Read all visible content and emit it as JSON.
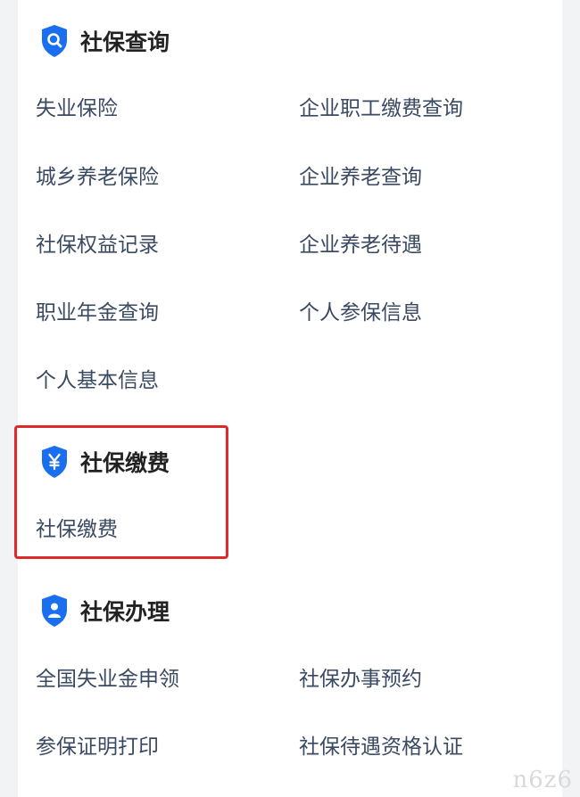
{
  "colors": {
    "accent": "#1a6ff0",
    "highlight": "#e0292b",
    "link": "#3a4a62",
    "title": "#222222"
  },
  "sections": {
    "query": {
      "title": "社保查询",
      "icon": "search-icon",
      "items": [
        "失业保险",
        "企业职工缴费查询",
        "城乡养老保险",
        "企业养老查询",
        "社保权益记录",
        "企业养老待遇",
        "职业年金查询",
        "个人参保信息",
        "个人基本信息"
      ]
    },
    "payment": {
      "title": "社保缴费",
      "icon": "yen-icon",
      "items": [
        "社保缴费"
      ]
    },
    "handling": {
      "title": "社保办理",
      "icon": "person-icon",
      "items": [
        "全国失业金申领",
        "社保办事预约",
        "参保证明打印",
        "社保待遇资格认证"
      ]
    }
  },
  "watermark": "n6z6"
}
